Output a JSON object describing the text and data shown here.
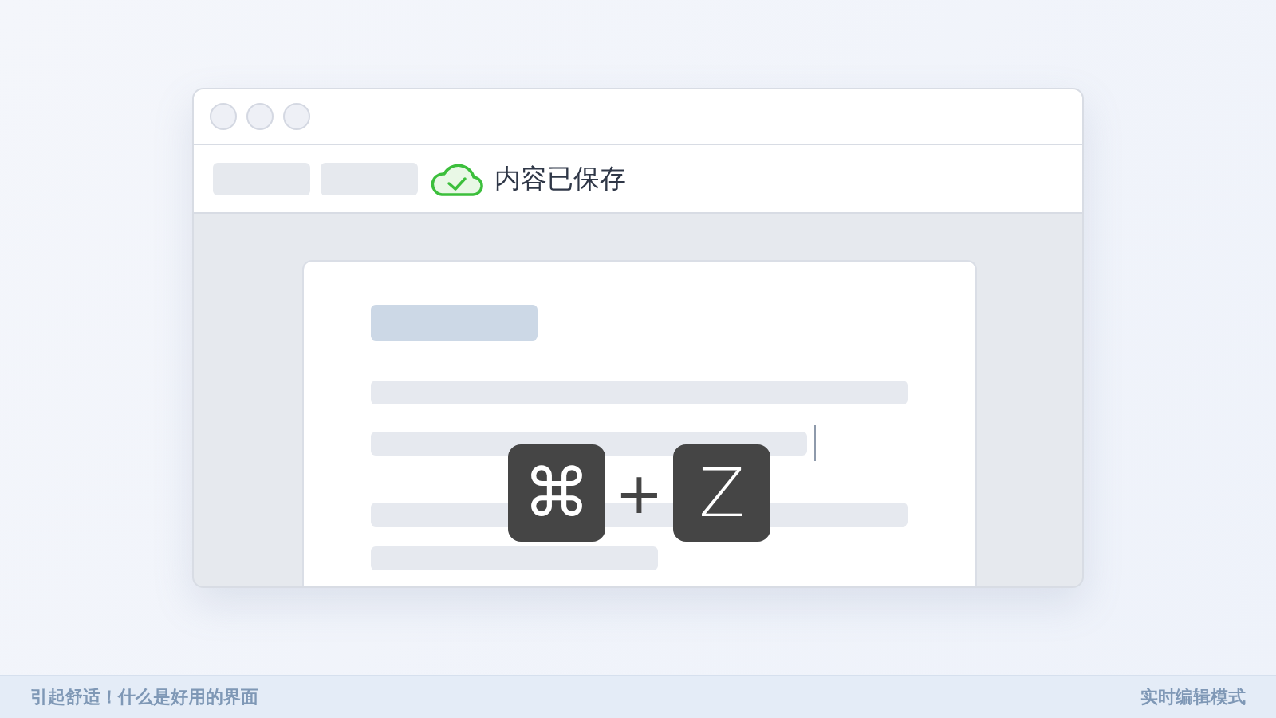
{
  "toolbar": {
    "status": "内容已保存"
  },
  "shortcut": {
    "keys": [
      "⌘",
      "Z"
    ],
    "joiner": "+"
  },
  "footer": {
    "left": "引起舒适！什么是好用的界面",
    "right": "实时编辑模式"
  }
}
